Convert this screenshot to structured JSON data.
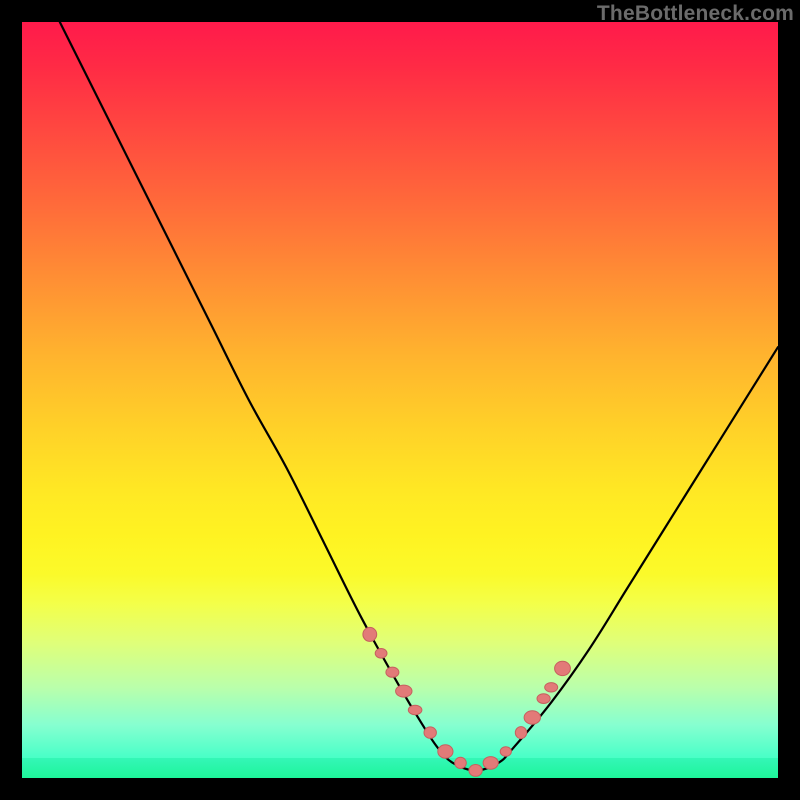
{
  "watermark": "TheBottleneck.com",
  "colors": {
    "frame_bg": "#000000",
    "curve": "#000000",
    "dot_fill": "#e27a78",
    "dot_stroke": "#c6605f",
    "gradient_top": "#ff1a4b",
    "gradient_bottom": "#2affb0"
  },
  "chart_data": {
    "type": "line",
    "title": "",
    "xlabel": "",
    "ylabel": "",
    "xlim": [
      0,
      100
    ],
    "ylim": [
      0,
      100
    ],
    "grid": false,
    "note": "V-shaped bottleneck curve; lower y = lower bottleneck. Values are approximate, read from pixel positions. Green band marks near-zero bottleneck region.",
    "series": [
      {
        "name": "bottleneck-curve",
        "x": [
          5,
          10,
          15,
          20,
          25,
          30,
          35,
          40,
          45,
          50,
          53,
          55,
          57,
          60,
          63,
          65,
          70,
          75,
          80,
          85,
          90,
          95,
          100
        ],
        "y": [
          100,
          90,
          80,
          70,
          60,
          50,
          41,
          31,
          21,
          12,
          7,
          4,
          2,
          1,
          2,
          4,
          10,
          17,
          25,
          33,
          41,
          49,
          57
        ]
      }
    ],
    "highlight_points": {
      "name": "optimal-zone-dots",
      "x": [
        46,
        47.5,
        49,
        50.5,
        52,
        54,
        56,
        58,
        60,
        62,
        64,
        66,
        67.5,
        69,
        70,
        71.5
      ],
      "y": [
        19,
        16.5,
        14,
        11.5,
        9,
        6,
        3.5,
        2,
        1,
        2,
        3.5,
        6,
        8,
        10.5,
        12,
        14.5
      ]
    }
  }
}
